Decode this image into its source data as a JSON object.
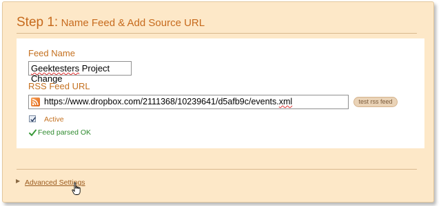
{
  "step": {
    "number_label": "Step 1:",
    "title": "Name Feed & Add Source URL"
  },
  "form": {
    "feed_name_label": "Feed Name",
    "feed_name_value": "Geektesters Project Change",
    "feed_name_value_parts": [
      "Geektesters",
      " Project Change"
    ],
    "rss_url_label": "RSS Feed URL",
    "rss_url_value": "https://www.dropbox.com/2111368/10239641/d5afb9c/events.xml",
    "rss_url_parts": [
      "https://www.dropbox.com/2111368/10239641/d5afb9c/events.",
      "xml"
    ],
    "test_button_label": "test rss feed",
    "active_label": "Active",
    "active_checked": true,
    "status_text": "Feed parsed OK"
  },
  "advanced": {
    "link_label": "Advanced Settings",
    "expanded": false
  },
  "icons": {
    "rss": "rss-feed-icon",
    "ok": "checkmark-icon",
    "expand": "triangle-right-icon",
    "cursor": "hand-pointer-icon"
  },
  "colors": {
    "panel_bg": "#fde8c8",
    "accent": "#c66a1d",
    "ok": "#2e8a2e"
  }
}
